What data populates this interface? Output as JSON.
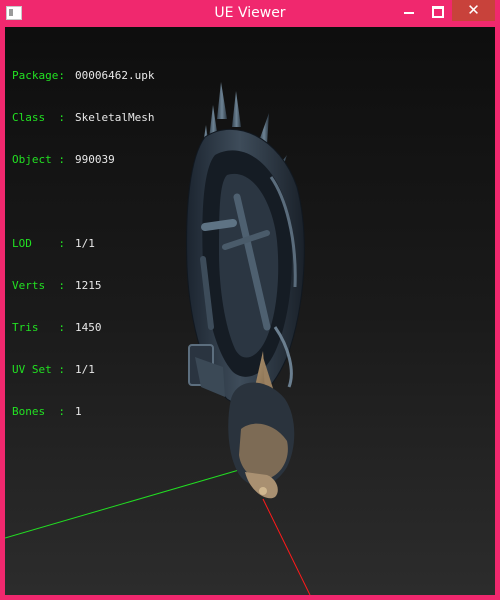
{
  "window": {
    "title": "UE Viewer"
  },
  "controls": {
    "minimize": "minimize-icon",
    "maximize": "maximize-icon",
    "close": "close-icon"
  },
  "colors": {
    "title_bar": "#f0286e",
    "label": "#22e022",
    "value": "#e8e8e8",
    "axis_x": "#ff1a1a",
    "axis_y": "#22dd22"
  },
  "info": {
    "header": [
      {
        "label": "Package:",
        "value": "00006462.upk"
      },
      {
        "label": "Class  :",
        "value": "SkeletalMesh"
      },
      {
        "label": "Object :",
        "value": "990039"
      }
    ],
    "stats": [
      {
        "label": "LOD    :",
        "value": "1/1"
      },
      {
        "label": "Verts  :",
        "value": "1215"
      },
      {
        "label": "Tris   :",
        "value": "1450"
      },
      {
        "label": "UV Set :",
        "value": "1/1"
      },
      {
        "label": "Bones  :",
        "value": "1"
      }
    ]
  }
}
